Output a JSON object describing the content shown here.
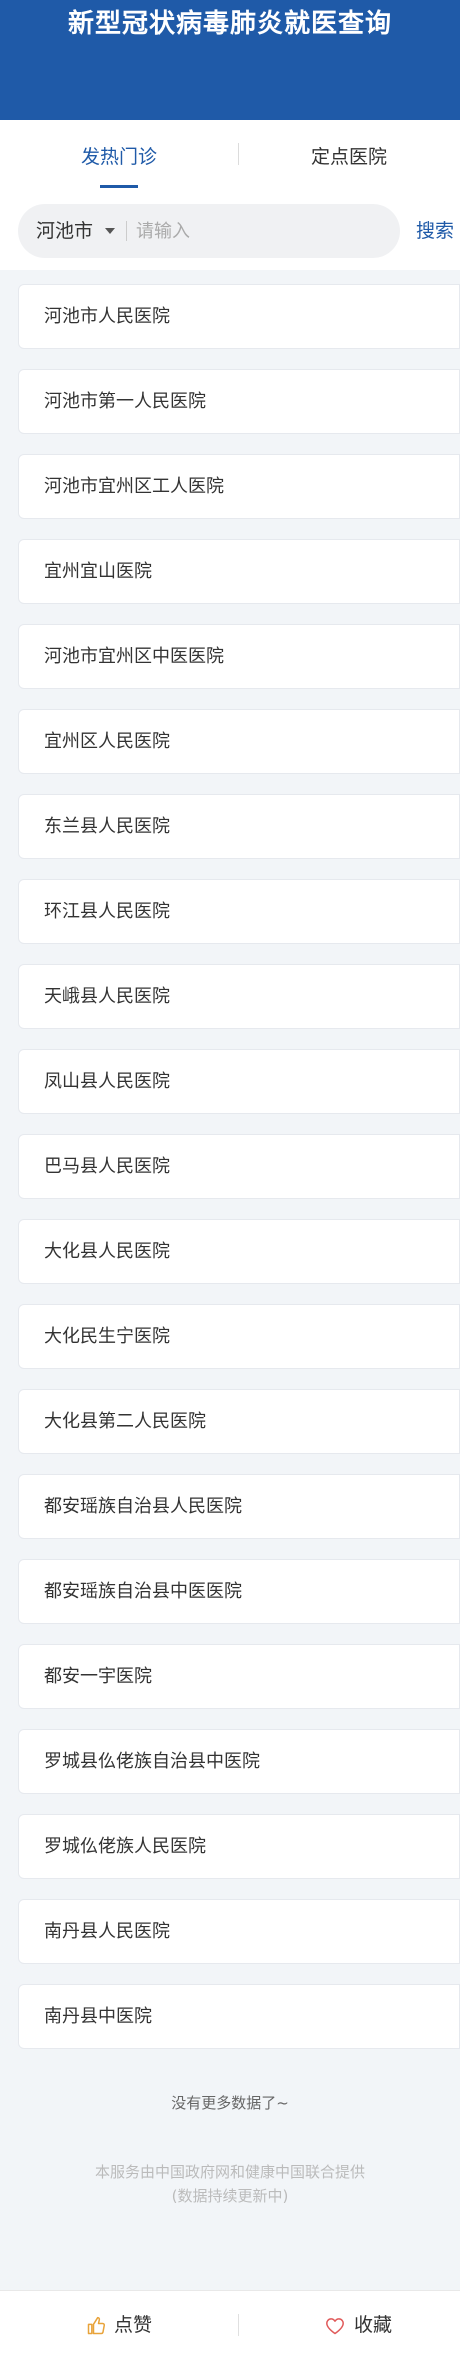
{
  "header": {
    "title": "新型冠状病毒肺炎就医查询"
  },
  "tabs": [
    {
      "label": "发热门诊",
      "active": true
    },
    {
      "label": "定点医院",
      "active": false
    }
  ],
  "search": {
    "city": "河池市",
    "placeholder": "请输入",
    "value": "",
    "button_label": "搜索"
  },
  "hospitals": [
    "河池市人民医院",
    "河池市第一人民医院",
    "河池市宜州区工人医院",
    "宜州宜山医院",
    "河池市宜州区中医医院",
    "宜州区人民医院",
    "东兰县人民医院",
    "环江县人民医院",
    "天峨县人民医院",
    "凤山县人民医院",
    "巴马县人民医院",
    "大化县人民医院",
    "大化民生宁医院",
    "大化县第二人民医院",
    "都安瑶族自治县人民医院",
    "都安瑶族自治县中医医院",
    "都安一宇医院",
    "罗城县仫佬族自治县中医院",
    "罗城仫佬族人民医院",
    "南丹县人民医院",
    "南丹县中医院"
  ],
  "list_end": "没有更多数据了~",
  "footer": {
    "line1": "本服务由中国政府网和健康中国联合提供",
    "line2": "(数据持续更新中)"
  },
  "bottom_bar": {
    "like_label": "点赞",
    "like_icon": "thumbs-up-icon",
    "favorite_label": "收藏",
    "favorite_icon": "heart-icon"
  },
  "colors": {
    "brand": "#1f5aa8",
    "background": "#f2f5f8",
    "like_icon": "#e8a33a",
    "favorite_icon": "#e05a5a"
  }
}
